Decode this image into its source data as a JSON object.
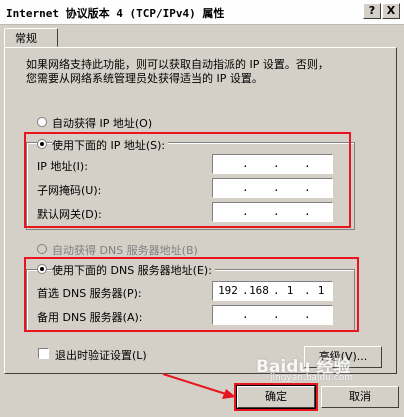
{
  "window": {
    "title": "Internet 协议版本 4 (TCP/IPv4) 属性"
  },
  "titlebar": {
    "help_label": "?",
    "close_label": "X"
  },
  "tab": {
    "label": "常规"
  },
  "description": {
    "line1": "如果网络支持此功能，则可以获取自动指派的 IP 设置。否则，",
    "line2": "您需要从网络系统管理员处获得适当的 IP 设置。"
  },
  "ip": {
    "auto_label": "自动获得 IP 地址(O)",
    "manual_label": "使用下面的 IP 地址(S):",
    "selected": "manual",
    "fields": [
      {
        "label": "IP 地址(I):",
        "value": [
          "",
          "",
          "",
          ""
        ]
      },
      {
        "label": "子网掩码(U):",
        "value": [
          "",
          "",
          "",
          ""
        ]
      },
      {
        "label": "默认网关(D):",
        "value": [
          "",
          "",
          "",
          ""
        ]
      }
    ]
  },
  "dns": {
    "auto_label": "自动获得 DNS 服务器地址(B)",
    "manual_label": "使用下面的 DNS 服务器地址(E):",
    "selected": "manual",
    "fields": [
      {
        "label": "首选 DNS 服务器(P):",
        "value": [
          "192",
          "168",
          "1",
          "1"
        ]
      },
      {
        "label": "备用 DNS 服务器(A):",
        "value": [
          "",
          "",
          "",
          ""
        ]
      }
    ]
  },
  "validate": {
    "label": "退出时验证设置(L)",
    "checked": false
  },
  "buttons": {
    "advanced": "高级(V)...",
    "ok": "确定",
    "cancel": "取消"
  },
  "watermark": {
    "text": "Baidu 经验",
    "url": "jingyan.baidu.com"
  },
  "colors": {
    "highlight": "#e8141e",
    "background": "#d4d0c8"
  }
}
